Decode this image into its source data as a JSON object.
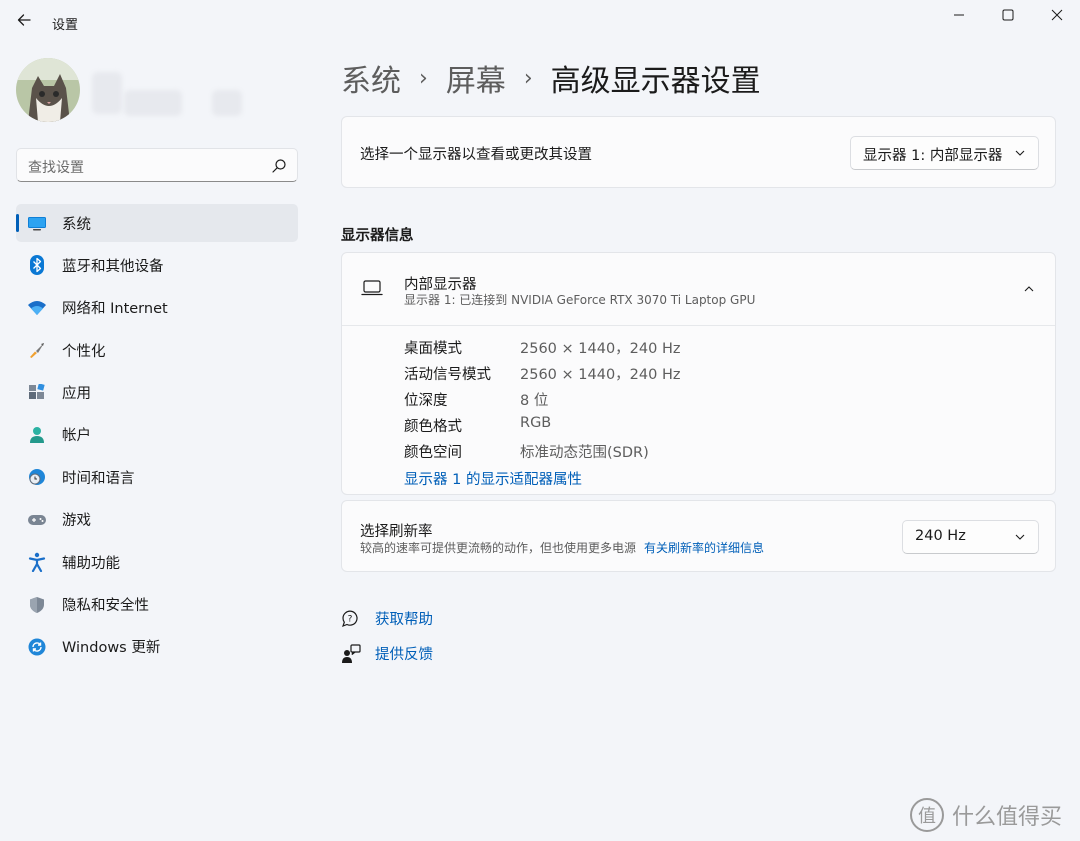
{
  "window": {
    "title": "设置"
  },
  "sidebar": {
    "search_placeholder": "查找设置",
    "items": [
      {
        "label": "系统",
        "icon": "system-icon",
        "active": true
      },
      {
        "label": "蓝牙和其他设备",
        "icon": "bluetooth-icon"
      },
      {
        "label": "网络和 Internet",
        "icon": "wifi-icon"
      },
      {
        "label": "个性化",
        "icon": "brush-icon"
      },
      {
        "label": "应用",
        "icon": "apps-icon"
      },
      {
        "label": "帐户",
        "icon": "account-icon"
      },
      {
        "label": "时间和语言",
        "icon": "time-language-icon"
      },
      {
        "label": "游戏",
        "icon": "gamepad-icon"
      },
      {
        "label": "辅助功能",
        "icon": "accessibility-icon"
      },
      {
        "label": "隐私和安全性",
        "icon": "shield-icon"
      },
      {
        "label": "Windows 更新",
        "icon": "update-icon"
      }
    ]
  },
  "breadcrumb": {
    "level1": "系统",
    "level2": "屏幕",
    "current": "高级显示器设置",
    "separator": "›"
  },
  "select_display": {
    "label": "选择一个显示器以查看或更改其设置",
    "value": "显示器 1: 内部显示器"
  },
  "display_info": {
    "section_title": "显示器信息",
    "title": "内部显示器",
    "subtitle": "显示器 1: 已连接到 NVIDIA GeForce RTX 3070 Ti Laptop GPU",
    "rows": [
      {
        "key": "桌面模式",
        "value": "2560 × 1440，240 Hz"
      },
      {
        "key": "活动信号模式",
        "value": "2560 × 1440，240 Hz"
      },
      {
        "key": "位深度",
        "value": "8 位"
      },
      {
        "key": "颜色格式",
        "value": "RGB"
      },
      {
        "key": "颜色空间",
        "value": "标准动态范围(SDR)"
      }
    ],
    "adapter_link": "显示器 1 的显示适配器属性"
  },
  "refresh_rate": {
    "title": "选择刷新率",
    "description": "较高的速率可提供更流畅的动作，但也使用更多电源",
    "link": "有关刷新率的详细信息",
    "value": "240 Hz"
  },
  "help": {
    "get_help": "获取帮助",
    "feedback": "提供反馈"
  },
  "watermark": {
    "logo_char": "值",
    "text": "什么值得买"
  },
  "colors": {
    "accent": "#005fb8",
    "background": "#f3f5f9",
    "card": "#fbfbfc"
  }
}
